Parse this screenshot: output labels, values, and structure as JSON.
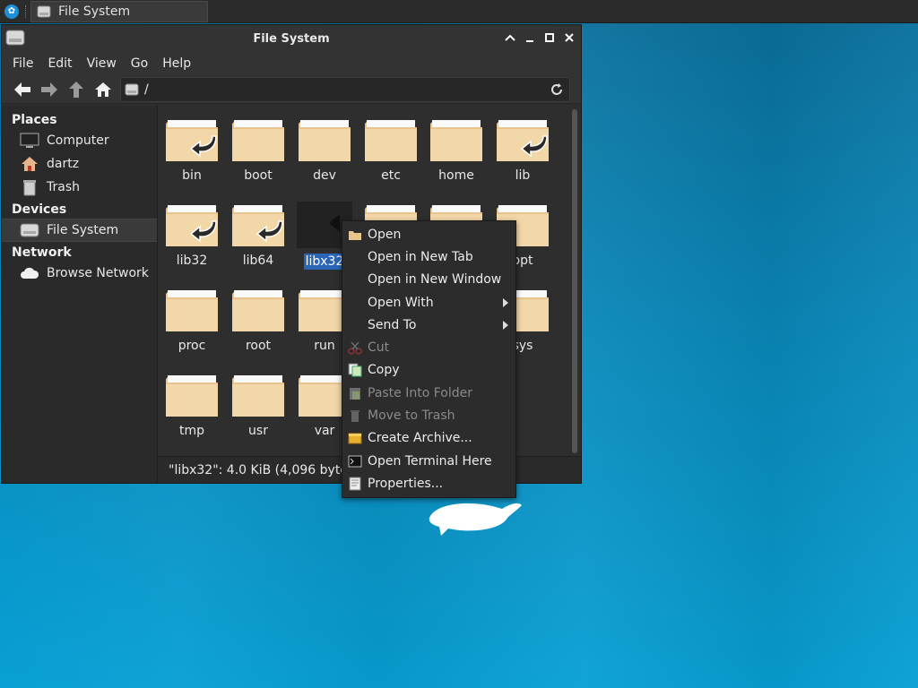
{
  "panel": {
    "task_title": "File System"
  },
  "window": {
    "title": "File System",
    "menu": [
      "File",
      "Edit",
      "View",
      "Go",
      "Help"
    ],
    "path": "/",
    "sidebar": {
      "places_label": "Places",
      "places": [
        {
          "label": "Computer",
          "icon": "computer-icon"
        },
        {
          "label": "dartz",
          "icon": "home-icon"
        },
        {
          "label": "Trash",
          "icon": "trash-icon"
        }
      ],
      "devices_label": "Devices",
      "devices": [
        {
          "label": "File System",
          "icon": "drive-icon"
        }
      ],
      "network_label": "Network",
      "network": [
        {
          "label": "Browse Network",
          "icon": "cloud-icon"
        }
      ]
    },
    "files": [
      {
        "name": "bin",
        "link": true
      },
      {
        "name": "boot",
        "link": false
      },
      {
        "name": "dev",
        "link": false
      },
      {
        "name": "etc",
        "link": false
      },
      {
        "name": "home",
        "link": false
      },
      {
        "name": "lib",
        "link": true
      },
      {
        "name": "lib32",
        "link": true
      },
      {
        "name": "lib64",
        "link": true
      },
      {
        "name": "libx32",
        "link": true,
        "selected": true
      },
      {
        "name": "",
        "link": false
      },
      {
        "name": "",
        "link": false
      },
      {
        "name": "opt",
        "link": false
      },
      {
        "name": "proc",
        "link": false
      },
      {
        "name": "root",
        "link": false,
        "locked": true
      },
      {
        "name": "run",
        "link": false
      },
      {
        "name": "",
        "link": false
      },
      {
        "name": "",
        "link": false
      },
      {
        "name": "sys",
        "link": false
      },
      {
        "name": "tmp",
        "link": false
      },
      {
        "name": "usr",
        "link": false
      },
      {
        "name": "var",
        "link": false
      }
    ],
    "status": "\"libx32\": 4.0 KiB (4,096 bytes"
  },
  "context_menu": {
    "items": [
      {
        "label": "Open",
        "icon": "folder-icon",
        "enabled": true
      },
      {
        "label": "Open in New Tab",
        "icon": "",
        "enabled": true
      },
      {
        "label": "Open in New Window",
        "icon": "",
        "enabled": true
      },
      {
        "label": "Open With",
        "icon": "",
        "enabled": true,
        "submenu": true
      },
      {
        "label": "Send To",
        "icon": "",
        "enabled": true,
        "submenu": true
      },
      {
        "label": "Cut",
        "icon": "scissors-icon",
        "enabled": false
      },
      {
        "label": "Copy",
        "icon": "copy-icon",
        "enabled": true
      },
      {
        "label": "Paste Into Folder",
        "icon": "paste-icon",
        "enabled": false
      },
      {
        "label": "Move to Trash",
        "icon": "trash-icon",
        "enabled": false
      },
      {
        "label": "Create Archive...",
        "icon": "archive-icon",
        "enabled": true
      },
      {
        "label": "Open Terminal Here",
        "icon": "terminal-icon",
        "enabled": true
      },
      {
        "label": "Properties...",
        "icon": "properties-icon",
        "enabled": true
      }
    ]
  },
  "colors": {
    "selection": "#2a66b5",
    "folder": "#f2d7a8",
    "desktop": "#0a87b8"
  }
}
